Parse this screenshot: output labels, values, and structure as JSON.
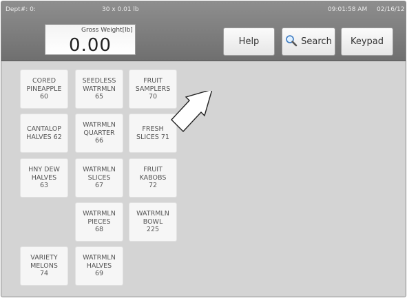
{
  "header": {
    "dept": "Dept#: 0:",
    "scale_info": "30 x 0.01 lb",
    "time": "09:01:58 AM",
    "date": "02/16/12"
  },
  "scale": {
    "label": "Gross  Weight[lb]",
    "value": "0.00"
  },
  "buttons": {
    "help": "Help",
    "search": "Search",
    "search_icon": "magnifier-icon",
    "keypad": "Keypad"
  },
  "products": [
    {
      "label": "CORED\nPINEAPPLE\n60"
    },
    {
      "label": "SEEDLESS\nWATRMLN\n65"
    },
    {
      "label": "FRUIT\nSAMPLERS\n70"
    },
    {
      "label": "CANTALOP\nHALVES 62"
    },
    {
      "label": "WATRMLN\nQUARTER\n66"
    },
    {
      "label": "FRESH\nSLICES 71"
    },
    {
      "label": "HNY DEW\nHALVES\n63"
    },
    {
      "label": "WATRMLN\nSLICES\n67"
    },
    {
      "label": "FRUIT\nKABOBS\n72"
    },
    {
      "label": "WATRMLN\nPIECES\n68"
    },
    {
      "label": "WATRMLN\nBOWL\n225"
    },
    {
      "label": "VARIETY\nMELONS\n74"
    },
    {
      "label": "WATRMLN\nHALVES\n69"
    }
  ],
  "colors": {
    "header": "#7e7e7e",
    "workspace": "#d4d4d4",
    "tile": "#f6f6f6"
  }
}
